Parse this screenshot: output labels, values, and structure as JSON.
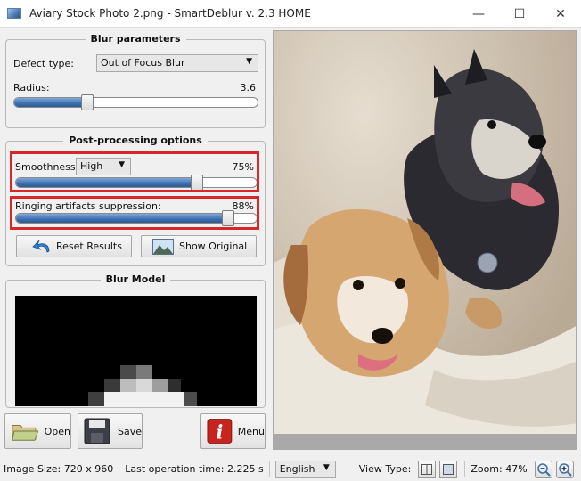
{
  "window": {
    "title": "Aviary Stock Photo 2.png - SmartDeblur v. 2.3 HOME",
    "minimize": "—",
    "maximize": "☐",
    "close": "✕"
  },
  "blur_params": {
    "title": "Blur parameters",
    "defect_label": "Defect type:",
    "defect_value": "Out of Focus Blur",
    "radius_label": "Radius:",
    "radius_value": "3.6",
    "radius_level": 0.3
  },
  "post": {
    "title": "Post-processing options",
    "smoothness_label": "Smoothness:",
    "smoothness_mode": "High",
    "smoothness_value": "75%",
    "smoothness_level": 0.75,
    "ringing_label": "Ringing artifacts suppression:",
    "ringing_value": "88%",
    "ringing_level": 0.88,
    "reset_label": "Reset Results",
    "show_label": "Show Original"
  },
  "blur_model": {
    "title": "Blur Model"
  },
  "actions": {
    "open": "Open",
    "save": "Save",
    "menu": "Menu"
  },
  "status": {
    "image_size": "Image Size: 720 x 960",
    "last_op": "Last operation time: 2.225 s",
    "language": "English",
    "view_type": "View Type:",
    "zoom": "Zoom: 47%"
  }
}
